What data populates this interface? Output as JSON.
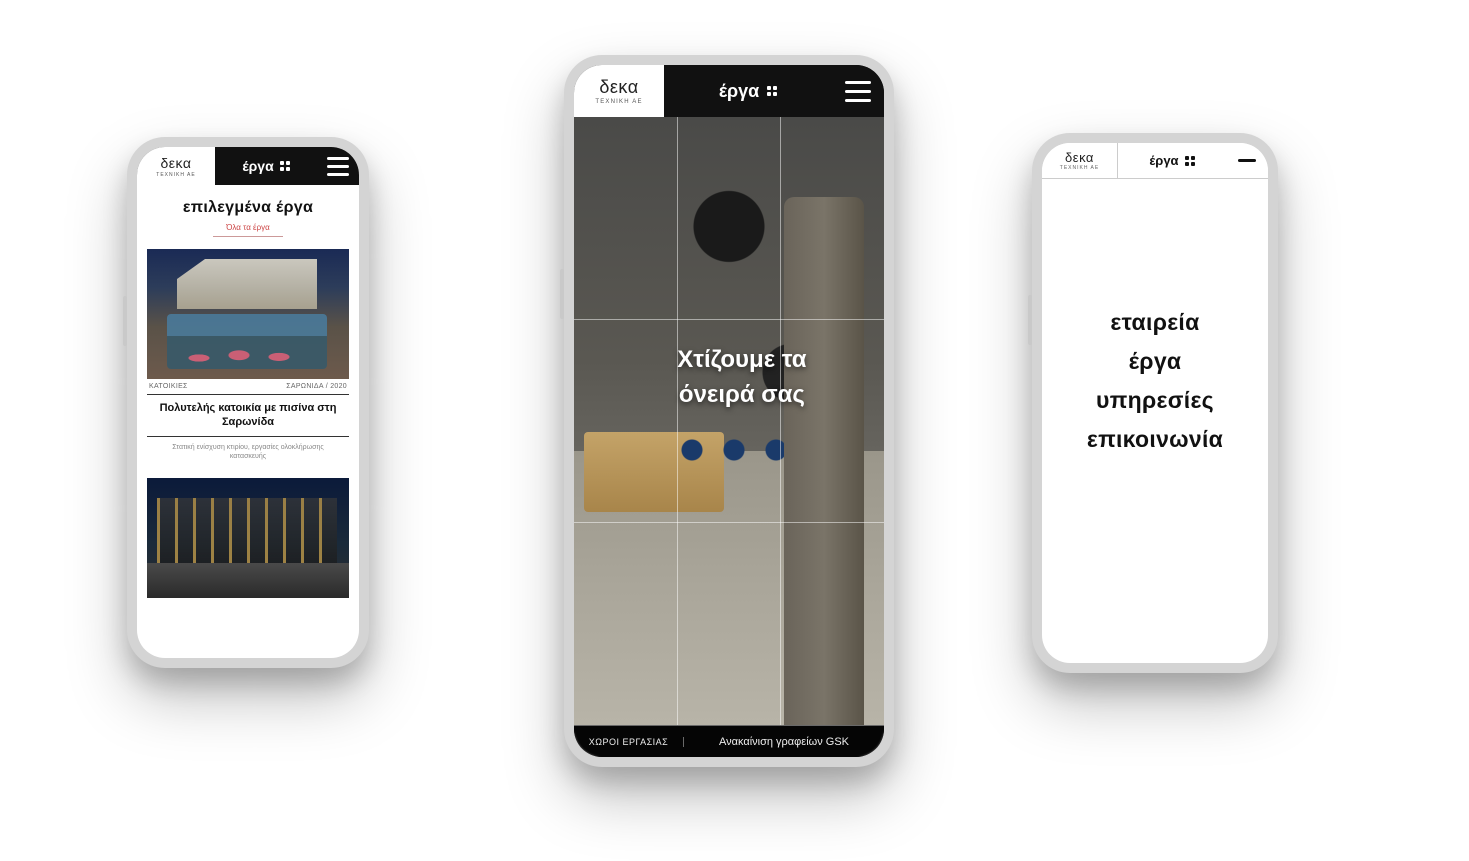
{
  "brand": {
    "name": "δεκα",
    "sub": "ΤΕΧΝΙΚΗ ΑΕ"
  },
  "nav_label": "έργα",
  "phone1": {
    "heading": "επιλεγμένα έργα",
    "subheading": "Όλα τα έργα",
    "card1": {
      "category": "ΚΑΤΟΙΚΙΕΣ",
      "location_year": "ΣΑΡΩΝΙΔΑ / 2020",
      "title": "Πολυτελής κατοικία με πισίνα στη Σαρωνίδα",
      "desc": "Στατική ενίσχυση κτιρίου, εργασίες ολοκλήρωσης κατασκευής"
    }
  },
  "phone2": {
    "slogan": "Χτίζουμε τα\nόνειρά σας",
    "footer_category": "ΧΩΡΟΙ ΕΡΓΑΣΙΑΣ",
    "footer_project": "Ανακαίνιση γραφείων GSK"
  },
  "phone3": {
    "menu": {
      "company": "εταιρεία",
      "projects": "έργα",
      "services": "υπηρεσίες",
      "contact": "επικοινωνία"
    }
  }
}
